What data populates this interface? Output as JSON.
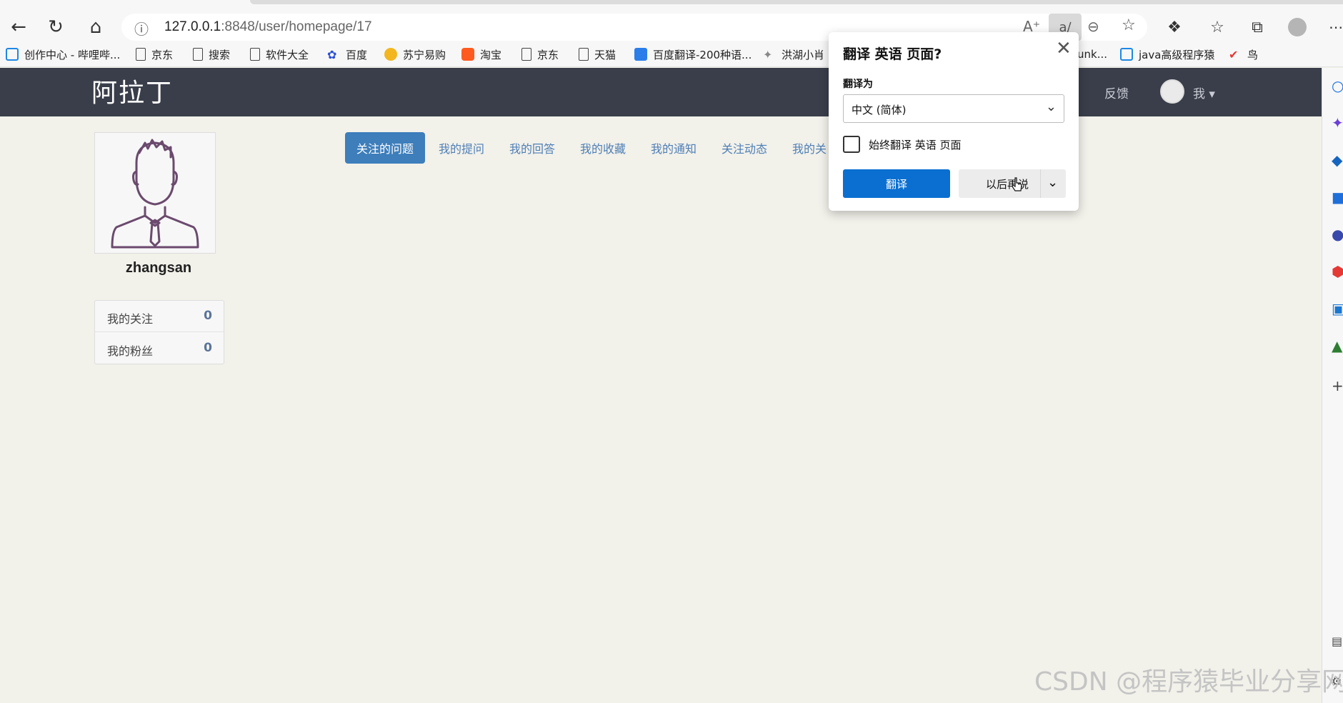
{
  "browser": {
    "url_host": "127.0.0.1",
    "url_rest": ":8848/user/homepage/17",
    "bookmarks": [
      "创作中心 - 哔哩哔...",
      "京东",
      "搜索",
      "软件大全",
      "百度",
      "苏宁易购",
      "淘宝",
      "京东",
      "天猫",
      "百度翻译-200种语...",
      "洪湖小肖",
      "unk...",
      "java高级程序猿",
      "鸟"
    ]
  },
  "site": {
    "logo": "阿拉丁",
    "feedback": "反馈",
    "me": "我"
  },
  "profile": {
    "username": "zhangsan",
    "stats": [
      {
        "label": "我的关注",
        "value": "0"
      },
      {
        "label": "我的粉丝",
        "value": "0"
      }
    ]
  },
  "tabs": [
    "关注的问题",
    "我的提问",
    "我的回答",
    "我的收藏",
    "我的通知",
    "关注动态",
    "我的关"
  ],
  "translate_popup": {
    "title": "翻译 英语 页面?",
    "translate_to_label": "翻译为",
    "language": "中文 (简体)",
    "always_label": "始终翻译 英语 页面",
    "translate_button": "翻译",
    "later_button": "以后再说"
  },
  "watermark": "CSDN @程序猿毕业分享网",
  "colors": {
    "navbar": "#3a3e4a",
    "accent": "#3d7ebb",
    "translate_button": "#0a6fd1"
  }
}
